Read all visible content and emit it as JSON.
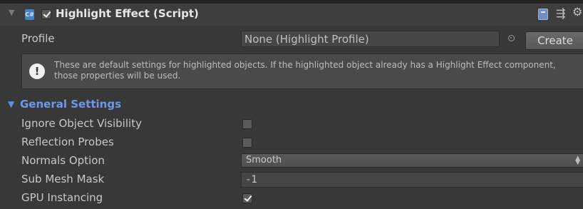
{
  "component": {
    "title": "Highlight Effect (Script)",
    "enabled": true,
    "script_icon_text": "C#"
  },
  "profile": {
    "label": "Profile",
    "value": "None (Highlight Profile)",
    "create_label": "Create"
  },
  "help": {
    "text": "These are default settings for highlighted objects. If the highlighted object already has a Highlight Effect component, those properties will be used."
  },
  "general_settings": {
    "title": "General Settings",
    "ignore_object_visibility": {
      "label": "Ignore Object Visibility",
      "checked": false
    },
    "reflection_probes": {
      "label": "Reflection Probes",
      "checked": false
    },
    "normals_option": {
      "label": "Normals Option",
      "value": "Smooth"
    },
    "sub_mesh_mask": {
      "label": "Sub Mesh Mask",
      "value": "-1"
    },
    "gpu_instancing": {
      "label": "GPU Instancing",
      "checked": true
    }
  },
  "icons": {
    "fold": "triangle-down-icon",
    "script": "csharp-script-icon",
    "help_book": "help-book-icon",
    "presets": "presets-icon",
    "settings": "gear-icon",
    "object_picker": "object-picker-icon",
    "info": "info-icon"
  },
  "colors": {
    "background": "#383838",
    "header": "#3e3e3e",
    "section_title": "#6d99ea",
    "text": "#c8c8c8"
  }
}
